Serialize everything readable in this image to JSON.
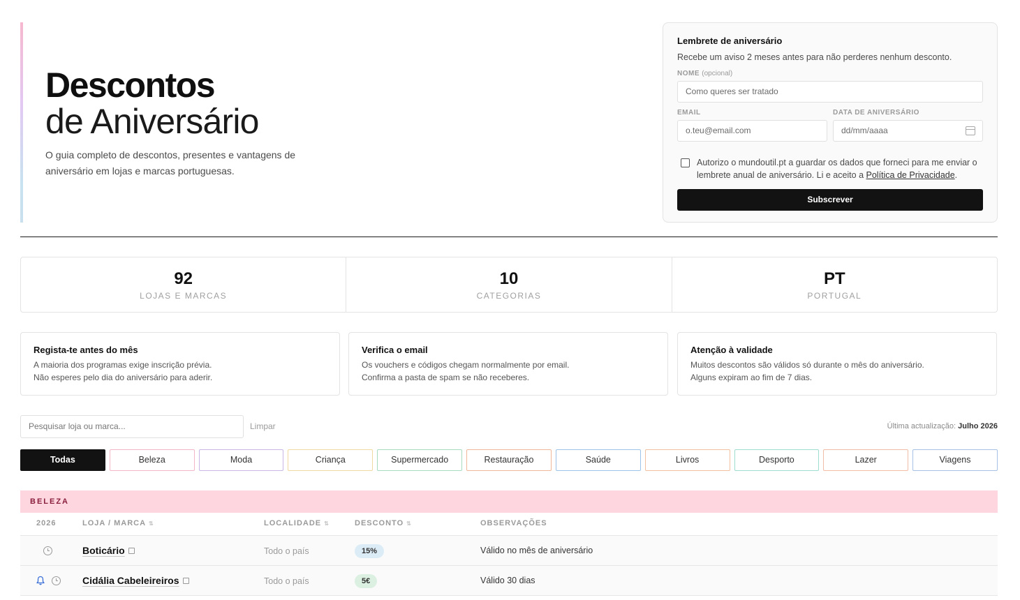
{
  "hero": {
    "title_line1": "Descontos",
    "title_line2": "de Aniversário",
    "subtitle": "O guia completo de descontos, presentes e vantagens de aniversário em lojas e marcas portuguesas."
  },
  "reminder": {
    "title": "Lembrete de aniversário",
    "description": "Recebe um aviso 2 meses antes para não perderes nenhum desconto.",
    "name_label": "NOME",
    "name_optional": "(opcional)",
    "name_placeholder": "Como queres ser tratado",
    "email_label": "EMAIL",
    "email_placeholder": "o.teu@email.com",
    "birthday_label": "DATA DE ANIVERSÁRIO",
    "birthday_placeholder": "dd/mm/aaaa",
    "consent_text": "Autorizo o mundoutil.pt a guardar os dados que forneci para me enviar o lembrete anual de aniversário. Li e aceito a ",
    "privacy_link": "Política de Privacidade",
    "consent_end": ".",
    "submit_label": "Subscrever"
  },
  "stats": [
    {
      "value": "92",
      "label": "LOJAS E MARCAS"
    },
    {
      "value": "10",
      "label": "CATEGORIAS"
    },
    {
      "value": "PT",
      "label": "PORTUGAL"
    }
  ],
  "tips": [
    {
      "title": "Regista-te antes do mês",
      "line1": "A maioria dos programas exige inscrição prévia.",
      "line2": "Não esperes pelo dia do aniversário para aderir."
    },
    {
      "title": "Verifica o email",
      "line1": "Os vouchers e códigos chegam normalmente por email.",
      "line2": "Confirma a pasta de spam se não receberes."
    },
    {
      "title": "Atenção à validade",
      "line1": "Muitos descontos são válidos só durante o mês do aniversário.",
      "line2": "Alguns expiram ao fim de 7 dias."
    }
  ],
  "search": {
    "placeholder": "Pesquisar loja ou marca...",
    "clear_label": "Limpar",
    "updated_prefix": "Última actualização:",
    "updated_value": "Julho 2026"
  },
  "filters": [
    {
      "label": "Todas",
      "color": "#121212"
    },
    {
      "label": "Beleza",
      "color": "#f2b6c6"
    },
    {
      "label": "Moda",
      "color": "#c8b6e6"
    },
    {
      "label": "Criança",
      "color": "#f1d9a2"
    },
    {
      "label": "Supermercado",
      "color": "#a8dcc0"
    },
    {
      "label": "Restauração",
      "color": "#f0b89a"
    },
    {
      "label": "Saúde",
      "color": "#9ec3e8"
    },
    {
      "label": "Livros",
      "color": "#f0c0a0"
    },
    {
      "label": "Desporto",
      "color": "#9fdcd0"
    },
    {
      "label": "Lazer",
      "color": "#f2bda6"
    },
    {
      "label": "Viagens",
      "color": "#a6c0e6"
    }
  ],
  "table": {
    "category": "BELEZA",
    "headers": {
      "year": "2026",
      "brand": "LOJA / MARCA",
      "location": "LOCALIDADE",
      "discount": "DESCONTO",
      "notes": "OBSERVAÇÕES"
    },
    "rows": [
      {
        "brand": "Boticário",
        "location": "Todo o país",
        "discount": "15%",
        "discount_color": "#dcecf6",
        "notes": "Válido no mês de aniversário",
        "bell": false
      },
      {
        "brand": "Cidália Cabeleireiros",
        "location": "Todo o país",
        "discount": "5€",
        "discount_color": "#dcf0e2",
        "notes": "Válido 30 dias",
        "bell": true
      }
    ]
  }
}
